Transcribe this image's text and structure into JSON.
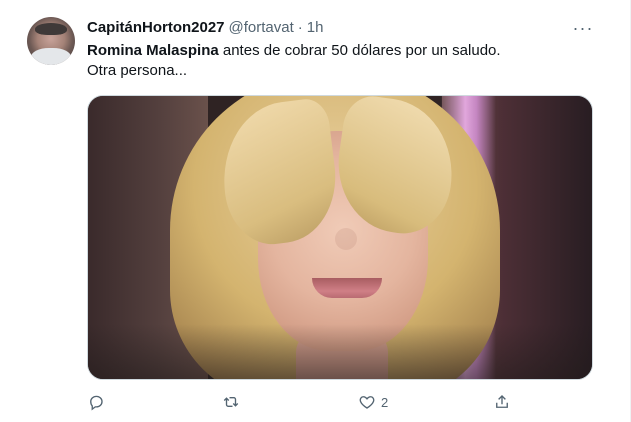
{
  "tweet": {
    "display_name": "CapitánHorton2027",
    "handle": "@fortavat",
    "separator": "·",
    "time": "1h",
    "text_mention": "Romina Malaspina",
    "text_rest_1": " antes de cobrar 50 dólares por un saludo.",
    "text_line_2": "Otra persona...",
    "like_count": "2",
    "more_icon": "more-horizontal-icon",
    "reply_icon": "reply-icon",
    "retweet_icon": "retweet-icon",
    "like_icon": "heart-icon",
    "share_icon": "share-icon"
  },
  "colors": {
    "text_primary": "#0f1419",
    "text_secondary": "#536471",
    "border": "#cfd9de"
  }
}
